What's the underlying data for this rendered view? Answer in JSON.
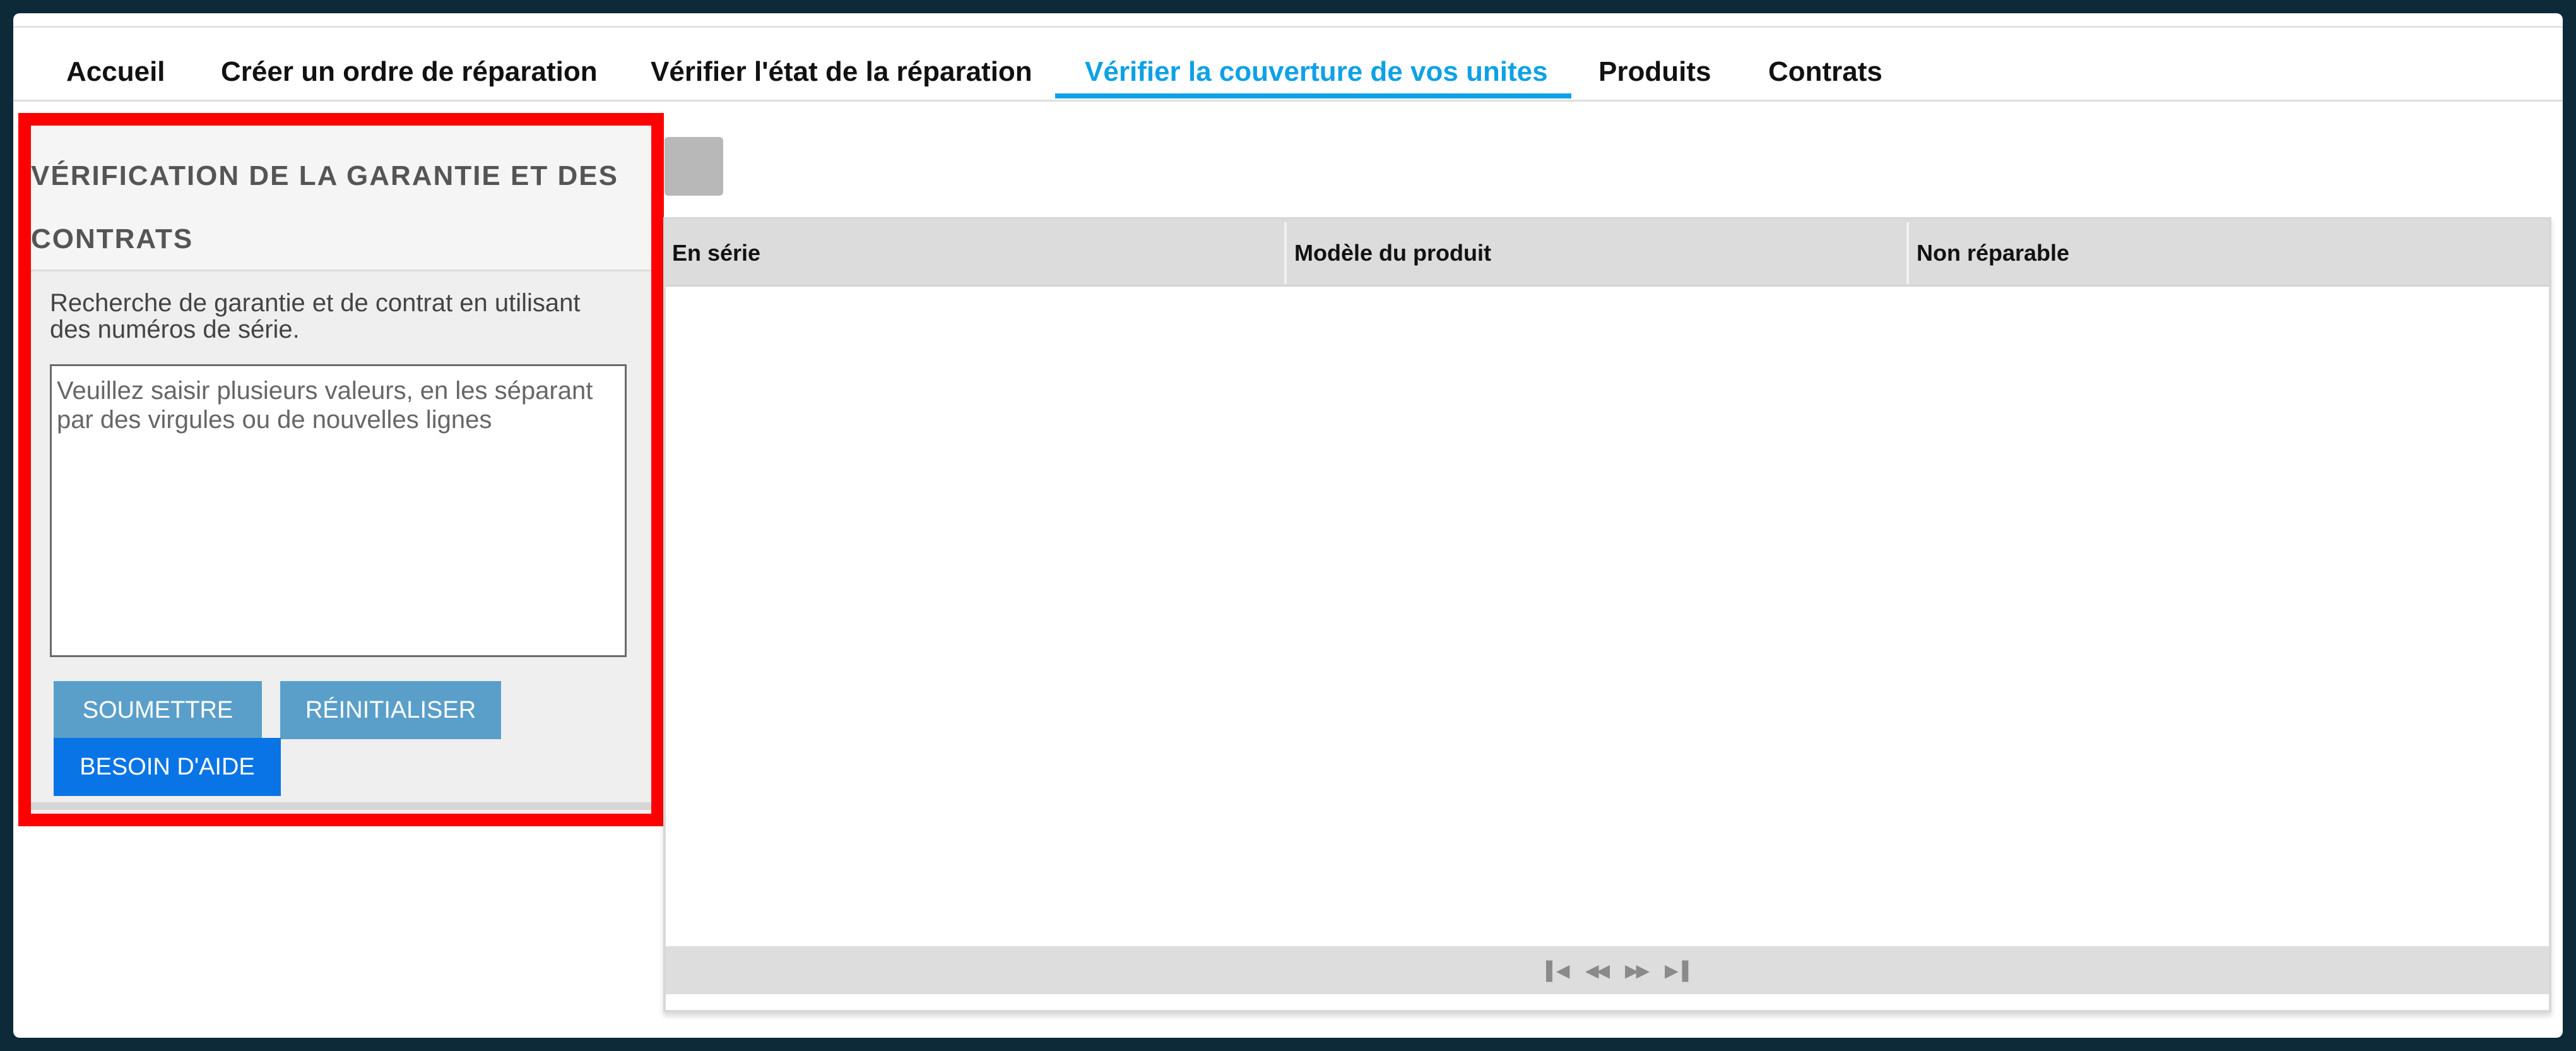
{
  "nav": {
    "items": [
      {
        "label": "Accueil",
        "active": false
      },
      {
        "label": "Créer un ordre de réparation",
        "active": false
      },
      {
        "label": "Vérifier l'état de la réparation",
        "active": false
      },
      {
        "label": "Vérifier la couverture de vos unites",
        "active": true
      },
      {
        "label": "Produits",
        "active": false
      },
      {
        "label": "Contrats",
        "active": false
      }
    ]
  },
  "panel": {
    "title": "VÉRIFICATION DE LA GARANTIE ET DES CONTRATS",
    "description": "Recherche de garantie et de contrat en utilisant des numéros de série.",
    "textarea_placeholder": "Veuillez saisir plusieurs valeurs, en les séparant par des virgules ou de nouvelles lignes",
    "textarea_value": "",
    "submit_label": "SOUMETTRE",
    "reset_label": "RÉINITIALISER",
    "help_label": "BESOIN D'AIDE"
  },
  "grid": {
    "columns": [
      "En série",
      "Modèle du produit",
      "Non réparable"
    ],
    "rows": [],
    "pager_icons": [
      "first-page-icon",
      "prev-page-icon",
      "next-page-icon",
      "last-page-icon"
    ]
  },
  "colors": {
    "accent": "#0ea1e6",
    "highlight_border": "#ff0000",
    "button_primary": "#5a9fca",
    "button_help": "#0974e6"
  }
}
